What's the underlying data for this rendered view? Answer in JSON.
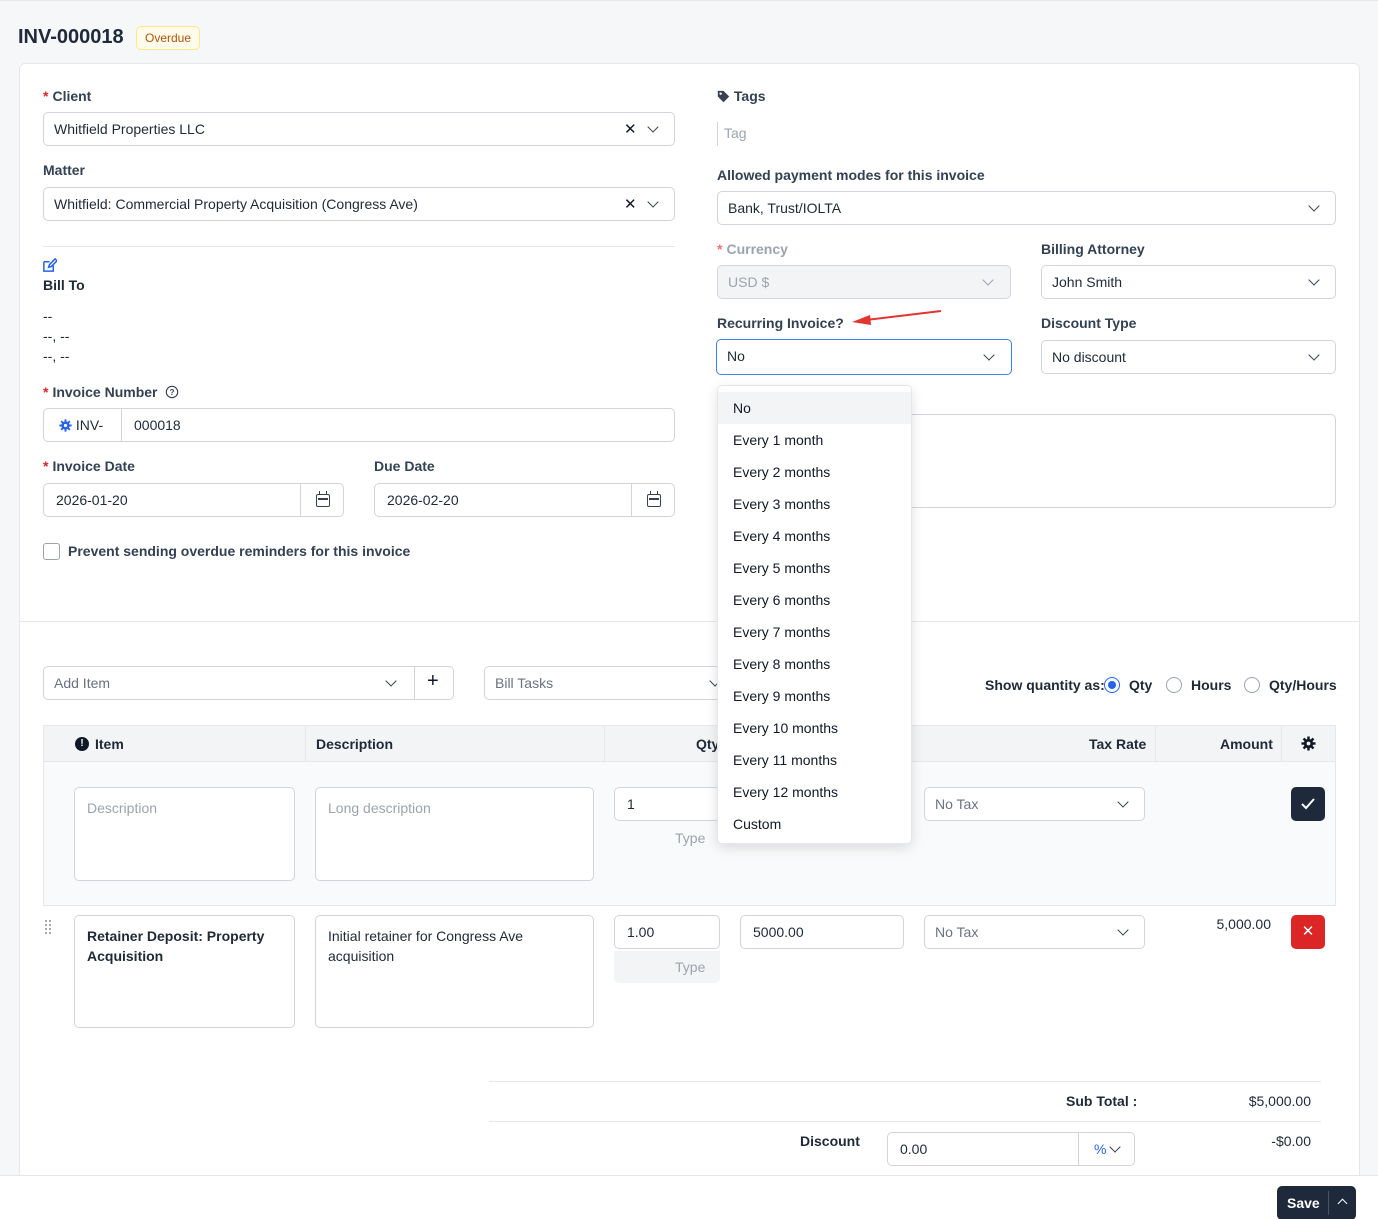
{
  "header": {
    "invoice_id": "INV-000018",
    "status": "Overdue"
  },
  "client": {
    "label": "Client",
    "value": "Whitfield Properties LLC"
  },
  "matter": {
    "label": "Matter",
    "value": "Whitfield: Commercial Property Acquisition (Congress Ave)"
  },
  "bill_to": {
    "label": "Bill To",
    "line1": "--",
    "line2": "--, --",
    "line3": "--, --"
  },
  "invoice_number": {
    "label": "Invoice Number",
    "prefix": "INV-",
    "value": "000018"
  },
  "invoice_date": {
    "label": "Invoice Date",
    "value": "2026-01-20"
  },
  "due_date": {
    "label": "Due Date",
    "value": "2026-02-20"
  },
  "prevent_reminders": {
    "label": "Prevent sending overdue reminders for this invoice",
    "checked": false
  },
  "tags": {
    "label": "Tags",
    "placeholder": "Tag"
  },
  "payment_modes": {
    "label": "Allowed payment modes for this invoice",
    "value": "Bank, Trust/IOLTA"
  },
  "currency": {
    "label": "Currency",
    "value": "USD $"
  },
  "billing_attorney": {
    "label": "Billing Attorney",
    "value": "John Smith"
  },
  "recurring": {
    "label": "Recurring Invoice?",
    "value": "No",
    "options": [
      "No",
      "Every 1 month",
      "Every 2 months",
      "Every 3 months",
      "Every 4 months",
      "Every 5 months",
      "Every 6 months",
      "Every 7 months",
      "Every 8 months",
      "Every 9 months",
      "Every 10 months",
      "Every 11 months",
      "Every 12 months",
      "Custom"
    ]
  },
  "discount_type": {
    "label": "Discount Type",
    "value": "No discount"
  },
  "items_toolbar": {
    "add_item_placeholder": "Add Item",
    "bill_tasks_placeholder": "Bill Tasks",
    "show_quantity_label": "Show quantity as:",
    "qty_options": [
      "Qty",
      "Hours",
      "Qty/Hours"
    ],
    "selected_qty_option": "Qty"
  },
  "table": {
    "headers": {
      "item": "Item",
      "description": "Description",
      "qty": "Qty",
      "tax_rate": "Tax Rate",
      "amount": "Amount"
    },
    "new_row": {
      "description_placeholder": "Description",
      "long_description_placeholder": "Long description",
      "qty": "1",
      "type_placeholder": "Type",
      "tax": "No Tax"
    },
    "rows": [
      {
        "item": "Retainer Deposit: Property Acquisition",
        "description": "Initial retainer for Congress Ave acquisition",
        "qty": "1.00",
        "type_placeholder": "Type",
        "rate": "5000.00",
        "tax": "No Tax",
        "amount": "5,000.00"
      }
    ]
  },
  "totals": {
    "subtotal_label": "Sub Total :",
    "subtotal_value": "$5,000.00",
    "discount_label": "Discount",
    "discount_input": "0.00",
    "discount_unit": "%",
    "discount_value": "-$0.00"
  },
  "footer": {
    "save_label": "Save"
  },
  "colors": {
    "accent": "#2563eb",
    "danger": "#dc2626",
    "dark": "#1e293b",
    "overdue_text": "#b45309",
    "overdue_bg": "#fffbeb",
    "arrow": "#e3342f"
  }
}
